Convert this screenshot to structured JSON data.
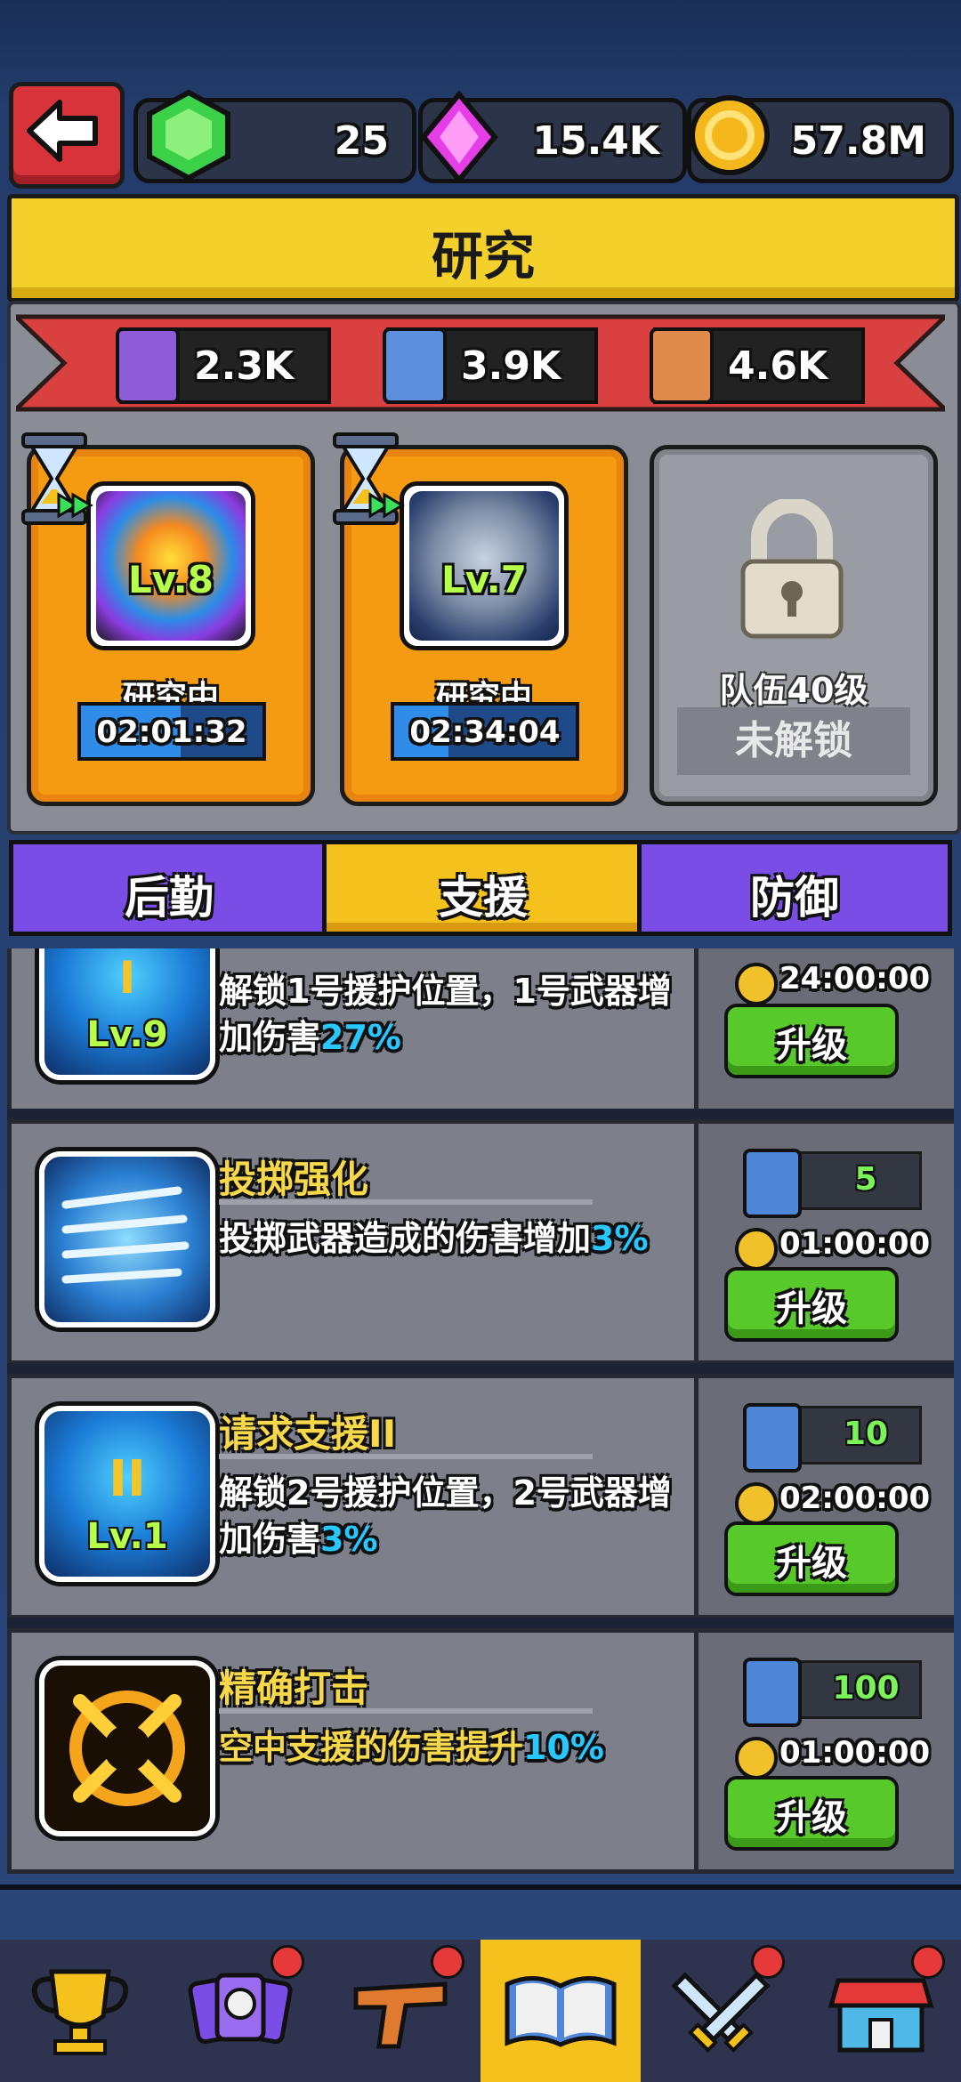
{
  "header": {
    "back_icon": "back-arrow-icon",
    "gems": "25",
    "crystals": "15.4K",
    "coins": "57.8M"
  },
  "title": "研究",
  "books": {
    "purple": "2.3K",
    "blue": "3.9K",
    "orange": "4.6K"
  },
  "research_slots": [
    {
      "level": "Lv.8",
      "status": "研究中",
      "timer": "02:01:32",
      "progress": 0.55
    },
    {
      "level": "Lv.7",
      "status": "研究中",
      "timer": "02:34:04",
      "progress": 0.3
    },
    {
      "locked_requirement": "队伍40级",
      "locked_label": "未解锁"
    }
  ],
  "tabs": {
    "logistics": "后勤",
    "support": "支援",
    "defense": "防御",
    "active": "support"
  },
  "items": [
    {
      "title": "",
      "level": "Lv.9",
      "roman": "I",
      "desc_main": "解锁1号援护位置，1号武器增加伤害",
      "desc_pct": "27%",
      "cost": "",
      "time": "24:00:00",
      "button": "升级"
    },
    {
      "title": "投掷强化",
      "desc_main": "投掷武器造成的伤害增加",
      "desc_pct": "3%",
      "cost": "5",
      "time": "01:00:00",
      "button": "升级"
    },
    {
      "title": "请求支援II",
      "level": "Lv.1",
      "roman": "II",
      "desc_main": "解锁2号援护位置，2号武器增加伤害",
      "desc_pct": "3%",
      "cost": "10",
      "time": "02:00:00",
      "button": "升级"
    },
    {
      "title": "精确打击",
      "desc_main": "空中支援的伤害提升",
      "desc_pct": "10%",
      "cost": "100",
      "time": "01:00:00",
      "button": "升级"
    }
  ],
  "nav": [
    "trophy-icon",
    "heroes-icon",
    "weapon-icon",
    "research-book-icon",
    "battle-icon",
    "shop-icon"
  ],
  "colors": {
    "accent_yellow": "#f3d12a",
    "tab_purple": "#7a4de6",
    "upgrade_green": "#58c92a",
    "highlight_cyan": "#29c7ff"
  }
}
